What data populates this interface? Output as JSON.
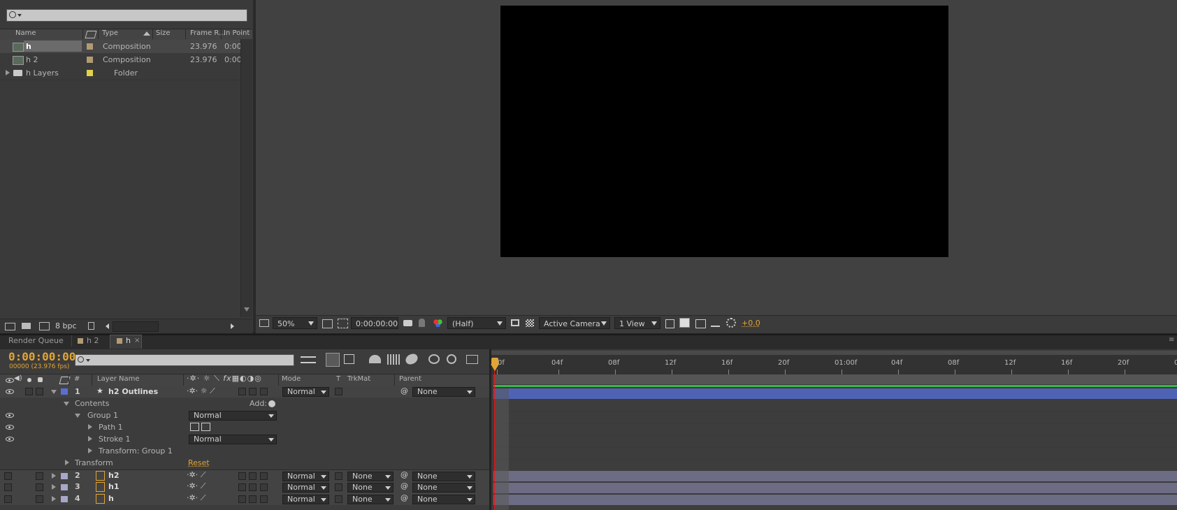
{
  "project": {
    "columns": [
      "Name",
      "Type",
      "Size",
      "Frame R...",
      "In Point"
    ],
    "items": [
      {
        "name": "h",
        "type": "Composition",
        "frame_rate": "23.976",
        "in_point": "0:00",
        "label_color": "#b29a73",
        "kind": "composition"
      },
      {
        "name": "h 2",
        "type": "Composition",
        "frame_rate": "23.976",
        "in_point": "0:00",
        "label_color": "#b29a73",
        "kind": "composition"
      },
      {
        "name": "h Layers",
        "type": "Folder",
        "frame_rate": "",
        "in_point": "",
        "label_color": "#e2d14a",
        "kind": "folder"
      }
    ],
    "bpc": "8 bpc"
  },
  "viewer": {
    "zoom": "50%",
    "timecode": "0:00:00:00",
    "resolution": "(Half)",
    "camera": "Active Camera",
    "views": "1 View",
    "exposure": "+0.0"
  },
  "tabs": [
    {
      "label": "Render Queue"
    },
    {
      "label": "h 2"
    },
    {
      "label": "h"
    }
  ],
  "timeline": {
    "current_time": "0:00:00:00",
    "frame_info": "00000 (23.976 fps)",
    "columns": {
      "number": "#",
      "layer_name": "Layer Name",
      "mode": "Mode",
      "t": "T",
      "trkmat": "TrkMat",
      "parent": "Parent"
    },
    "ruler_ticks": [
      "0f",
      "04f",
      "08f",
      "12f",
      "16f",
      "20f",
      "01:00f",
      "04f",
      "08f",
      "12f",
      "16f",
      "20f",
      "02:"
    ],
    "layers": [
      {
        "num": "1",
        "name": "h2 Outlines",
        "mode": "Normal",
        "trkmat": "",
        "parent": "None",
        "color": "#5b6ed0"
      },
      {
        "num": "2",
        "name": "h2",
        "mode": "Normal",
        "trkmat": "None",
        "parent": "None",
        "color": "#a7a7c9"
      },
      {
        "num": "3",
        "name": "h1",
        "mode": "Normal",
        "trkmat": "None",
        "parent": "None",
        "color": "#a7a7c9"
      },
      {
        "num": "4",
        "name": "h",
        "mode": "Normal",
        "trkmat": "None",
        "parent": "None",
        "color": "#a7a7c9"
      }
    ],
    "props": {
      "contents": "Contents",
      "add": "Add:",
      "group1": "Group 1",
      "group1_mode": "Normal",
      "path1": "Path 1",
      "stroke1": "Stroke 1",
      "stroke1_mode": "Normal",
      "transform_group": "Transform: Group 1",
      "transform": "Transform",
      "reset": "Reset"
    }
  },
  "colors": {
    "accent_orange": "#e2a535",
    "layer1_bar": "#4f63b4",
    "layer_bar": "#6c6c84",
    "green": "#3ab54a",
    "playhead": "#e11111"
  }
}
